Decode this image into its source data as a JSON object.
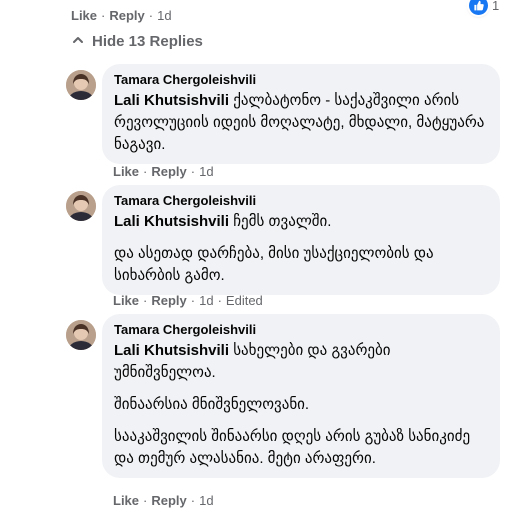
{
  "top_actions": {
    "like": "Like",
    "reply": "Reply",
    "time": "1d",
    "reaction_count": "1"
  },
  "hide_replies": "Hide 13 Replies",
  "comments": [
    {
      "author": "Tamara Chergoleishvili",
      "mention": "Lali Khutsishvili",
      "paragraphs": [
        "ქალბატონო - საქაკშვილი არის რევოლუციის იდეის მოღალატე, მხდალი, მატყუარა ნაგავი."
      ],
      "actions": {
        "like": "Like",
        "reply": "Reply",
        "time": "1d",
        "edited": ""
      }
    },
    {
      "author": "Tamara Chergoleishvili",
      "mention": "Lali Khutsishvili",
      "paragraphs": [
        "ჩემს თვალში.",
        "და ასეთად დარჩება, მისი უსაქციელობის და სიხარბის გამო."
      ],
      "actions": {
        "like": "Like",
        "reply": "Reply",
        "time": "1d",
        "edited": "Edited"
      }
    },
    {
      "author": "Tamara Chergoleishvili",
      "mention": "Lali Khutsishvili",
      "paragraphs": [
        "სახელები და გვარები უმნიშვნელოა.",
        "შინაარსია მნიშვნელოვანი.",
        "სააკაშვილის შინაარსი დღეს არის გუბაზ სანიკიძე და თემურ ალასანია. მეტი არაფერი."
      ],
      "actions": {
        "like": "Like",
        "reply": "Reply",
        "time": "1d",
        "edited": ""
      }
    }
  ],
  "colors": {
    "accent": "#1877f2",
    "bubble": "#f0f2f5",
    "muted": "#65676b"
  },
  "icons": {
    "reaction": "thumbs-up-icon",
    "toggle": "chevron-up-icon"
  }
}
